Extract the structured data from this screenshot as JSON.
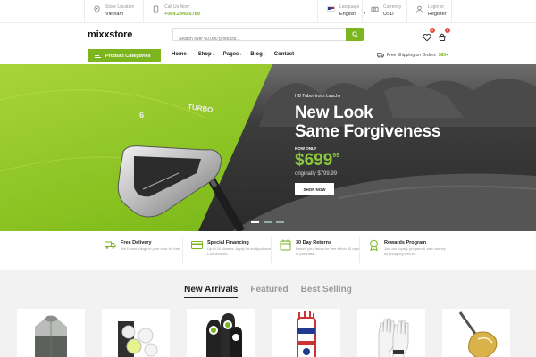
{
  "topbar": {
    "store_location": {
      "label": "Store Location",
      "value": "Vietnam"
    },
    "call_us": {
      "label": "Call Us Now:",
      "value": "+084.2345.6789"
    },
    "language": {
      "label": "Language",
      "value": "English"
    },
    "currency": {
      "label": "Currency",
      "value": "USD"
    },
    "account": {
      "label": "Login or",
      "value": "Register"
    }
  },
  "header": {
    "logo": "mixxstore",
    "search_placeholder": "Search over 60,000 products...",
    "wishlist_count": "0",
    "cart_count": "0"
  },
  "nav": {
    "categories_label": "Product Categories",
    "items": [
      {
        "label": "Home",
        "has_caret": true
      },
      {
        "label": "Shop",
        "has_caret": true
      },
      {
        "label": "Pages",
        "has_caret": true
      },
      {
        "label": "Blog",
        "has_caret": true
      },
      {
        "label": "Contact",
        "has_caret": false
      }
    ],
    "shipping_text": "Free Shipping on Orders",
    "shipping_amount": "$80+"
  },
  "hero": {
    "eyebrow": "HB Tubor Irons Lauche",
    "title_line1": "New Look",
    "title_line2": "Same Forgiveness",
    "now_only": "NOW ONLY",
    "price_main": "$699",
    "price_cents": "99",
    "original_price": "originally $799.99",
    "button": "SHOP NOW",
    "club_brand": "TURBO",
    "club_number": "6",
    "slides": 3,
    "active_slide": 1
  },
  "features": [
    {
      "title": "Free Delivery",
      "desc": "We'll send things to your door for free!",
      "icon": "truck-icon"
    },
    {
      "title": "Special Financing",
      "desc": "Up to 24 Months. Apply for an Appliances Connections.",
      "icon": "card-icon"
    },
    {
      "title": "30 Day Returns",
      "desc": "Return your items for free within 30 days of purchase.",
      "icon": "calendar-icon"
    },
    {
      "title": "Rewards Program",
      "desc": "Join our loyalty program & earn money by shopping with us.",
      "icon": "medal-icon"
    }
  ],
  "products": {
    "tabs": [
      "New Arrivals",
      "Featured",
      "Best Selling"
    ],
    "active_tab": 0
  },
  "colors": {
    "accent": "#7cb51e",
    "price": "#8cc63f",
    "badge": "#e84a3d"
  }
}
